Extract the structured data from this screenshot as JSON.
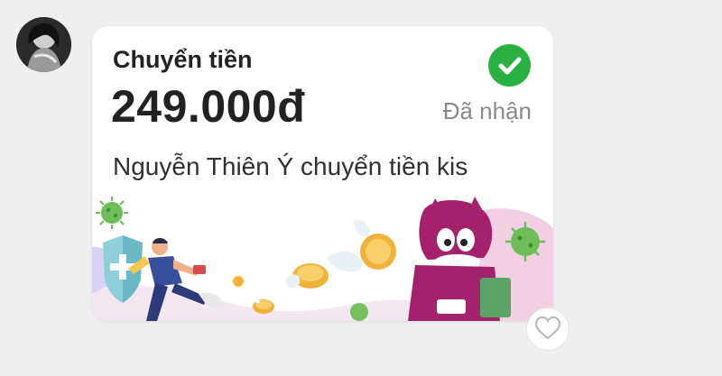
{
  "message": {
    "title": "Chuyển tiền",
    "amount": "249.000đ",
    "status": "Đã nhận",
    "description": "Nguyễn Thiên Ý chuyển tiền kis"
  },
  "icons": {
    "status": "check-circle-icon",
    "reaction": "heart-icon"
  },
  "colors": {
    "background": "#efefef",
    "card": "#ffffff",
    "success": "#2bb142",
    "mascot": "#a3226b"
  }
}
